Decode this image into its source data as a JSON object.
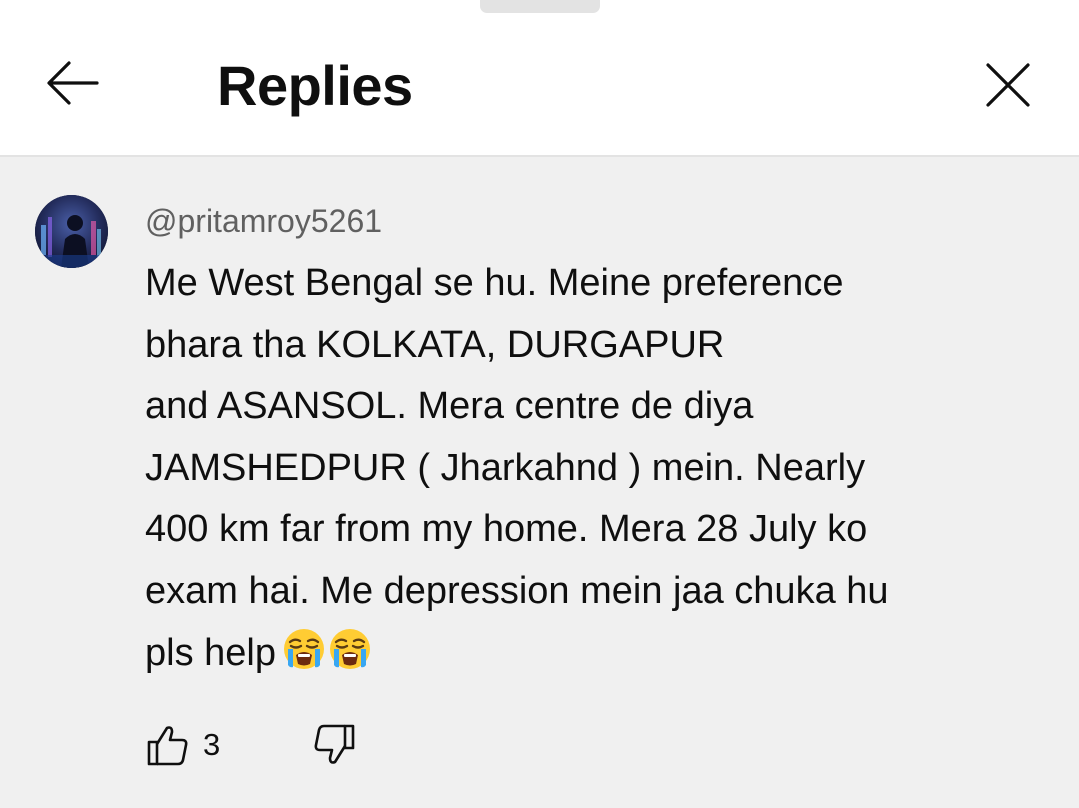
{
  "header": {
    "title": "Replies",
    "back_icon": "arrow-left-icon",
    "close_icon": "close-icon"
  },
  "comment": {
    "author": "@pritamroy5261",
    "text_lines": [
      "Me West Bengal se hu. Meine preference",
      "bhara tha KOLKATA, DURGAPUR",
      "and ASANSOL. Mera centre de diya",
      "JAMSHEDPUR ( Jharkahnd ) mein. Nearly",
      "400 km far from my home. Mera 28 July ko",
      "exam hai. Me depression mein jaa chuka hu",
      "pls help"
    ],
    "emojis": [
      "loudly-crying-face",
      "loudly-crying-face"
    ],
    "like_count": "3"
  },
  "colors": {
    "header_bg": "#ffffff",
    "comment_bg": "#f0f0f0",
    "text": "#0f0f0f",
    "secondary_text": "#606060",
    "divider": "#e3e3e3"
  }
}
